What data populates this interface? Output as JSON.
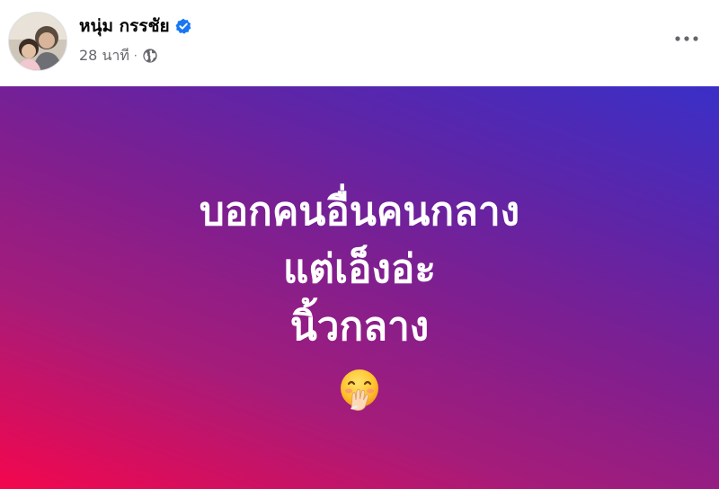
{
  "post": {
    "author_name": "หนุ่ม กรรชัย",
    "time_ago": "28 นาที",
    "separator": "·",
    "privacy_icon": "globe-icon",
    "verified_icon": "verified-badge-icon",
    "more_icon": "more-options-icon"
  },
  "status": {
    "lines": [
      "บอกคนอื่นคนกลาง",
      "แต่เอ็งอ่ะ",
      "นิ้วกลาง"
    ],
    "emoji": "face-with-hand-over-mouth-emoji"
  },
  "colors": {
    "gradient_start": "#f4064d",
    "gradient_end": "#3a2fc7",
    "verified_blue": "#1877f2",
    "meta_gray": "#65676b"
  }
}
